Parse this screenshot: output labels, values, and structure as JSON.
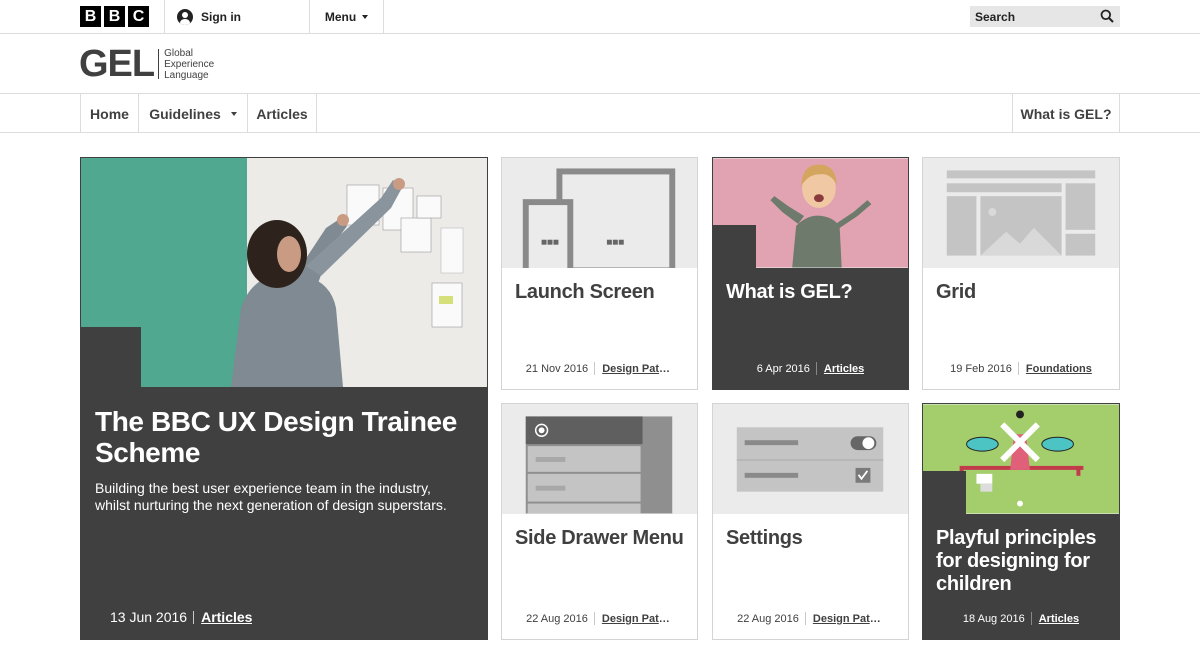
{
  "topbar": {
    "logo_letters": [
      "B",
      "B",
      "C"
    ],
    "signin_label": "Sign in",
    "menu_label": "Menu",
    "search_label": "Search"
  },
  "gel": {
    "word": "GEL",
    "sub_lines": [
      "Global",
      "Experience",
      "Language"
    ]
  },
  "nav": {
    "home": "Home",
    "guidelines": "Guidelines",
    "articles": "Articles",
    "what_is_gel": "What is GEL?"
  },
  "hero": {
    "title": "The BBC UX Design Trainee Scheme",
    "description": "Building the best user experience team in the industry, whilst nurturing the next generation of design superstars.",
    "date": "13 Jun 2016",
    "tag": "Articles"
  },
  "cards": [
    {
      "title": "Launch Screen",
      "date": "21 Nov 2016",
      "tag": "Design Patterns",
      "style": "light",
      "icon": "launch-screen-illustration"
    },
    {
      "title": "What is GEL?",
      "date": "6 Apr 2016",
      "tag": "Articles",
      "style": "dark",
      "icon": "child-photo"
    },
    {
      "title": "Grid",
      "date": "19 Feb 2016",
      "tag": "Foundations",
      "style": "light",
      "icon": "grid-illustration"
    },
    {
      "title": "Side Drawer Menu",
      "date": "22 Aug 2016",
      "tag": "Design Patterns",
      "style": "light",
      "icon": "side-drawer-illustration"
    },
    {
      "title": "Settings",
      "date": "22 Aug 2016",
      "tag": "Design Patterns",
      "style": "light",
      "icon": "settings-illustration"
    },
    {
      "title": "Playful principles for designing for children",
      "date": "18 Aug 2016",
      "tag": "Articles",
      "style": "dark",
      "icon": "windmill-illustration"
    }
  ],
  "colors": {
    "dark_card": "#404040",
    "thumb_bg": "#ebebeb",
    "hero_teal": "#4fa88f",
    "pink": "#e1a3b2",
    "green": "#a4cd6b"
  }
}
